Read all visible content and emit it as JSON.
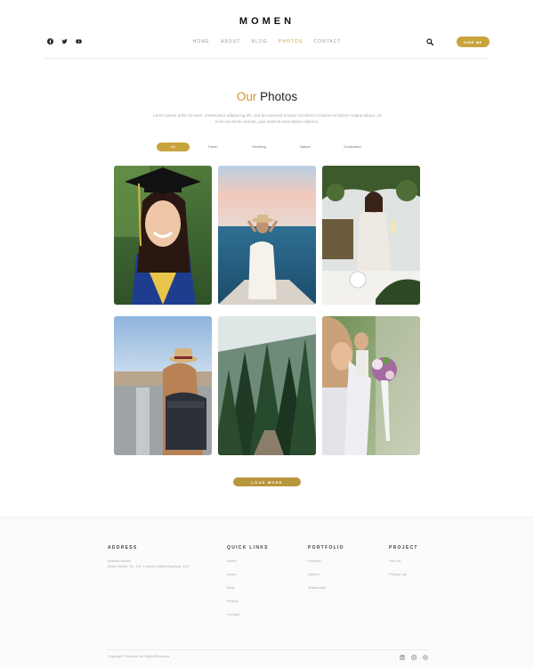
{
  "header": {
    "brand": "MOMEN",
    "social_icons": [
      "facebook-icon",
      "twitter-icon",
      "youtube-icon"
    ],
    "nav": [
      {
        "label": "HOME",
        "active": false
      },
      {
        "label": "ABOUT",
        "active": false
      },
      {
        "label": "BLOG",
        "active": false
      },
      {
        "label": "PHOTOS",
        "active": true
      },
      {
        "label": "CONTACT",
        "active": false
      }
    ],
    "hire_label": "HIRE ME",
    "accent_color": "#c9a33c"
  },
  "intro": {
    "title_accent": "Our",
    "title_rest": "Photos",
    "subtitle": "Lorem ipsum dolor sit amet, consectetur adipiscing elit, sed do eiusmod tempor incididunt ut labore et dolore magna aliqua. Ut enim ad minim veniam, quis nostrud exercitation ullamco."
  },
  "filters": [
    {
      "label": "All",
      "active": true
    },
    {
      "label": "Travel",
      "active": false
    },
    {
      "label": "Wedding",
      "active": false
    },
    {
      "label": "Nature",
      "active": false
    },
    {
      "label": "Graduation",
      "active": false
    }
  ],
  "photos": [
    "graduate-portrait",
    "woman-on-boat",
    "wedding-toast",
    "woman-with-backpack",
    "pine-forest",
    "bride-with-bouquet"
  ],
  "load_more_label": "LOAD MORE",
  "footer": {
    "address_heading": "ADDRESS",
    "address_lines": [
      "Momen Studio",
      "Baker Street, No. 1st, London United Kingdom, 15 F"
    ],
    "quick_links_heading": "QUICK LINKS",
    "quick_links": [
      "Home",
      "About",
      "Blog",
      "Photos",
      "Contact"
    ],
    "portfolio_heading": "PORTFOLIO",
    "portfolio_links": [
      "Portfolio",
      "Gallery",
      "Testimonial"
    ],
    "project_heading": "PROJECT",
    "project_links": [
      "Hire Us",
      "Pricing List"
    ],
    "copyright": "Copyright © Momen. All Rights Reserved.",
    "social_icons": [
      "linkedin-icon",
      "instagram-icon",
      "dribbble-icon"
    ]
  }
}
